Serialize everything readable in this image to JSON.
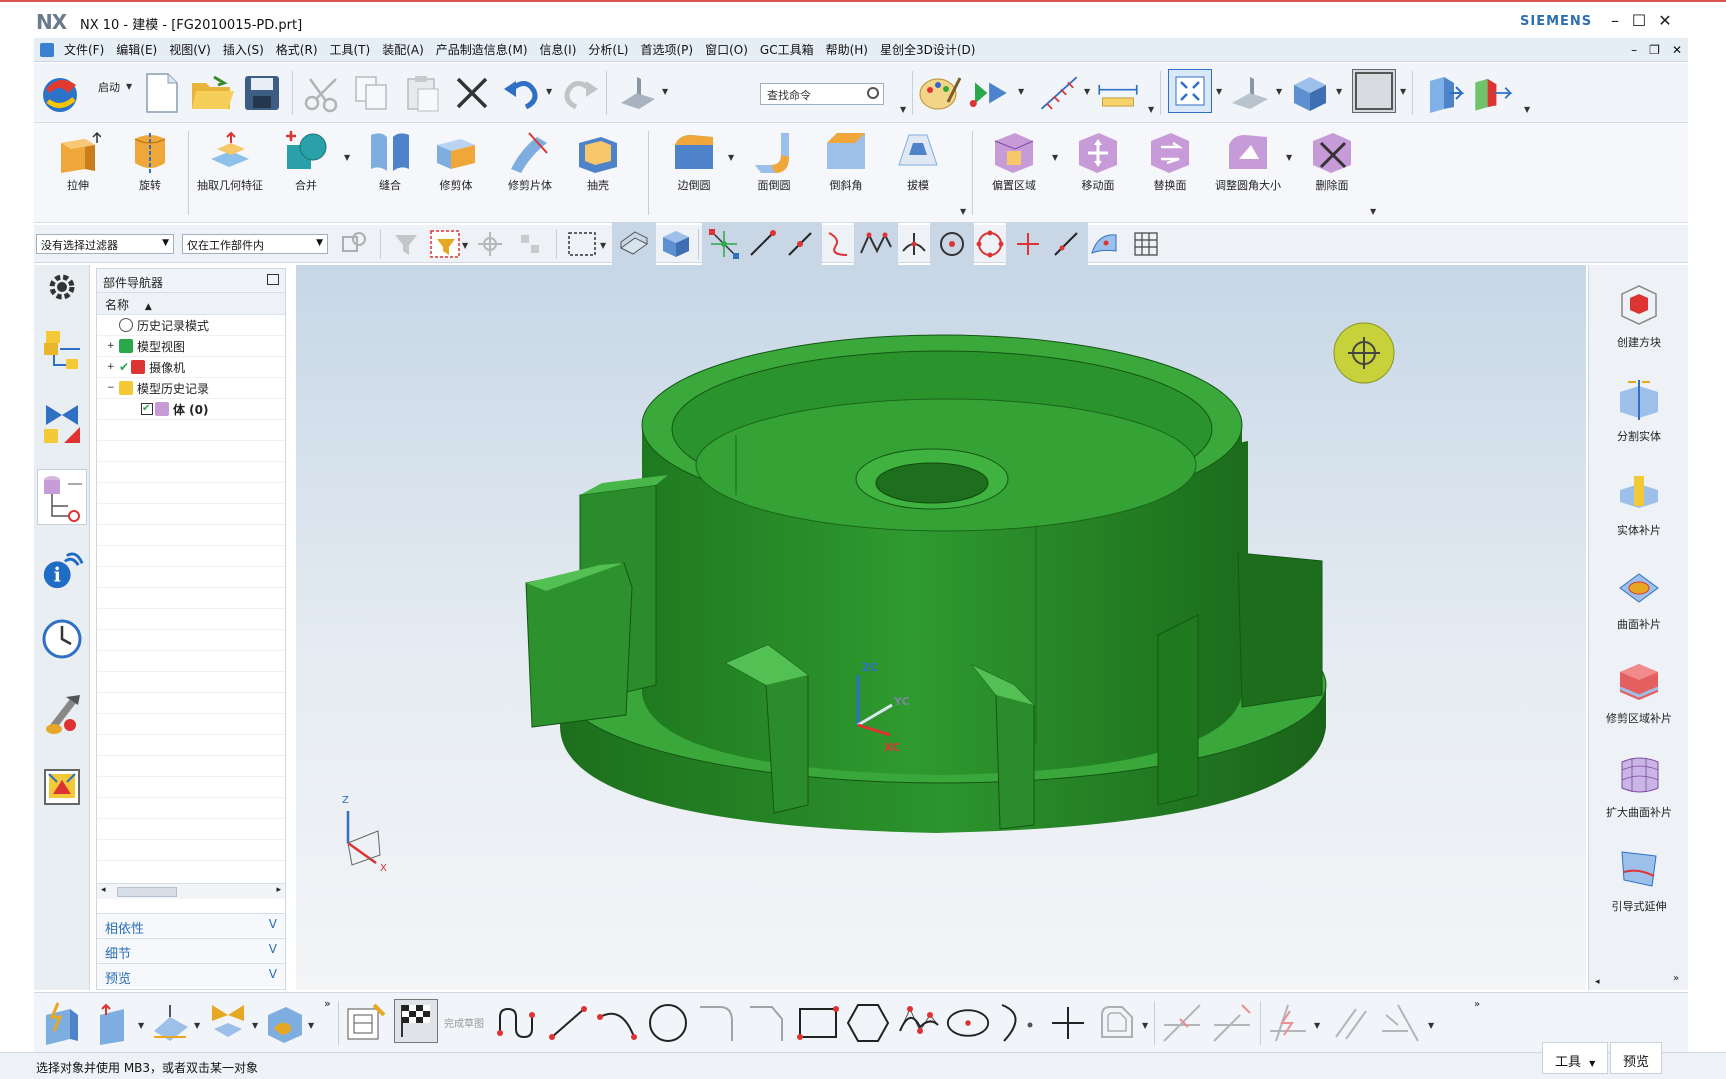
{
  "window": {
    "logo": "NX",
    "title": "NX 10 - 建模 - [FG2010015-PD.prt]",
    "brand": "SIEMENS",
    "minimize": "–",
    "maximize": "☐",
    "close": "✕"
  },
  "menubar": {
    "items": [
      "文件(F)",
      "编辑(E)",
      "视图(V)",
      "插入(S)",
      "格式(R)",
      "工具(T)",
      "装配(A)",
      "产品制造信息(M)",
      "信息(I)",
      "分析(L)",
      "首选项(P)",
      "窗口(O)",
      "GC工具箱",
      "帮助(H)",
      "星创全3D设计(D)"
    ],
    "doc_minimize": "–",
    "doc_restore": "❐",
    "doc_close": "✕"
  },
  "toolbar1": {
    "start_label": "启动",
    "search_placeholder": "查找命令"
  },
  "feature_toolbar": {
    "items": [
      "拉伸",
      "旋转",
      "抽取几何特征",
      "合并",
      "缝合",
      "修剪体",
      "修剪片体",
      "抽壳",
      "边倒圆",
      "面倒圆",
      "倒斜角",
      "拔模",
      "偏置区域",
      "移动面",
      "替换面",
      "调整圆角大小",
      "删除面"
    ]
  },
  "selection_bar": {
    "filter": "没有选择过滤器",
    "scope": "仅在工作部件内"
  },
  "navigator": {
    "title": "部件导航器",
    "column": "名称",
    "tree": [
      {
        "label": "历史记录模式",
        "indent": 0
      },
      {
        "label": "模型视图",
        "indent": 0
      },
      {
        "label": "摄像机",
        "indent": 0
      },
      {
        "label": "模型历史记录",
        "indent": 0
      },
      {
        "label": "体 (0)",
        "indent": 1
      }
    ],
    "sections": [
      "相依性",
      "细节",
      "预览"
    ]
  },
  "viewport": {
    "wcs_labels": {
      "z": "ZC",
      "y": "YC",
      "x": "XC"
    },
    "abs_labels": {
      "z": "Z",
      "x": "X"
    },
    "model_color": "#2f9a2f"
  },
  "rightbar": {
    "tools": [
      "创建方块",
      "分割实体",
      "实体补片",
      "曲面补片",
      "修剪区域补片",
      "扩大曲面补片",
      "引导式延伸"
    ]
  },
  "bottombar": {
    "finish_sketch": "完成草图"
  },
  "status": {
    "message": "选择对象并使用 MB3，或者双击某一对象",
    "tools_button": "工具",
    "preview_button": "预览"
  }
}
